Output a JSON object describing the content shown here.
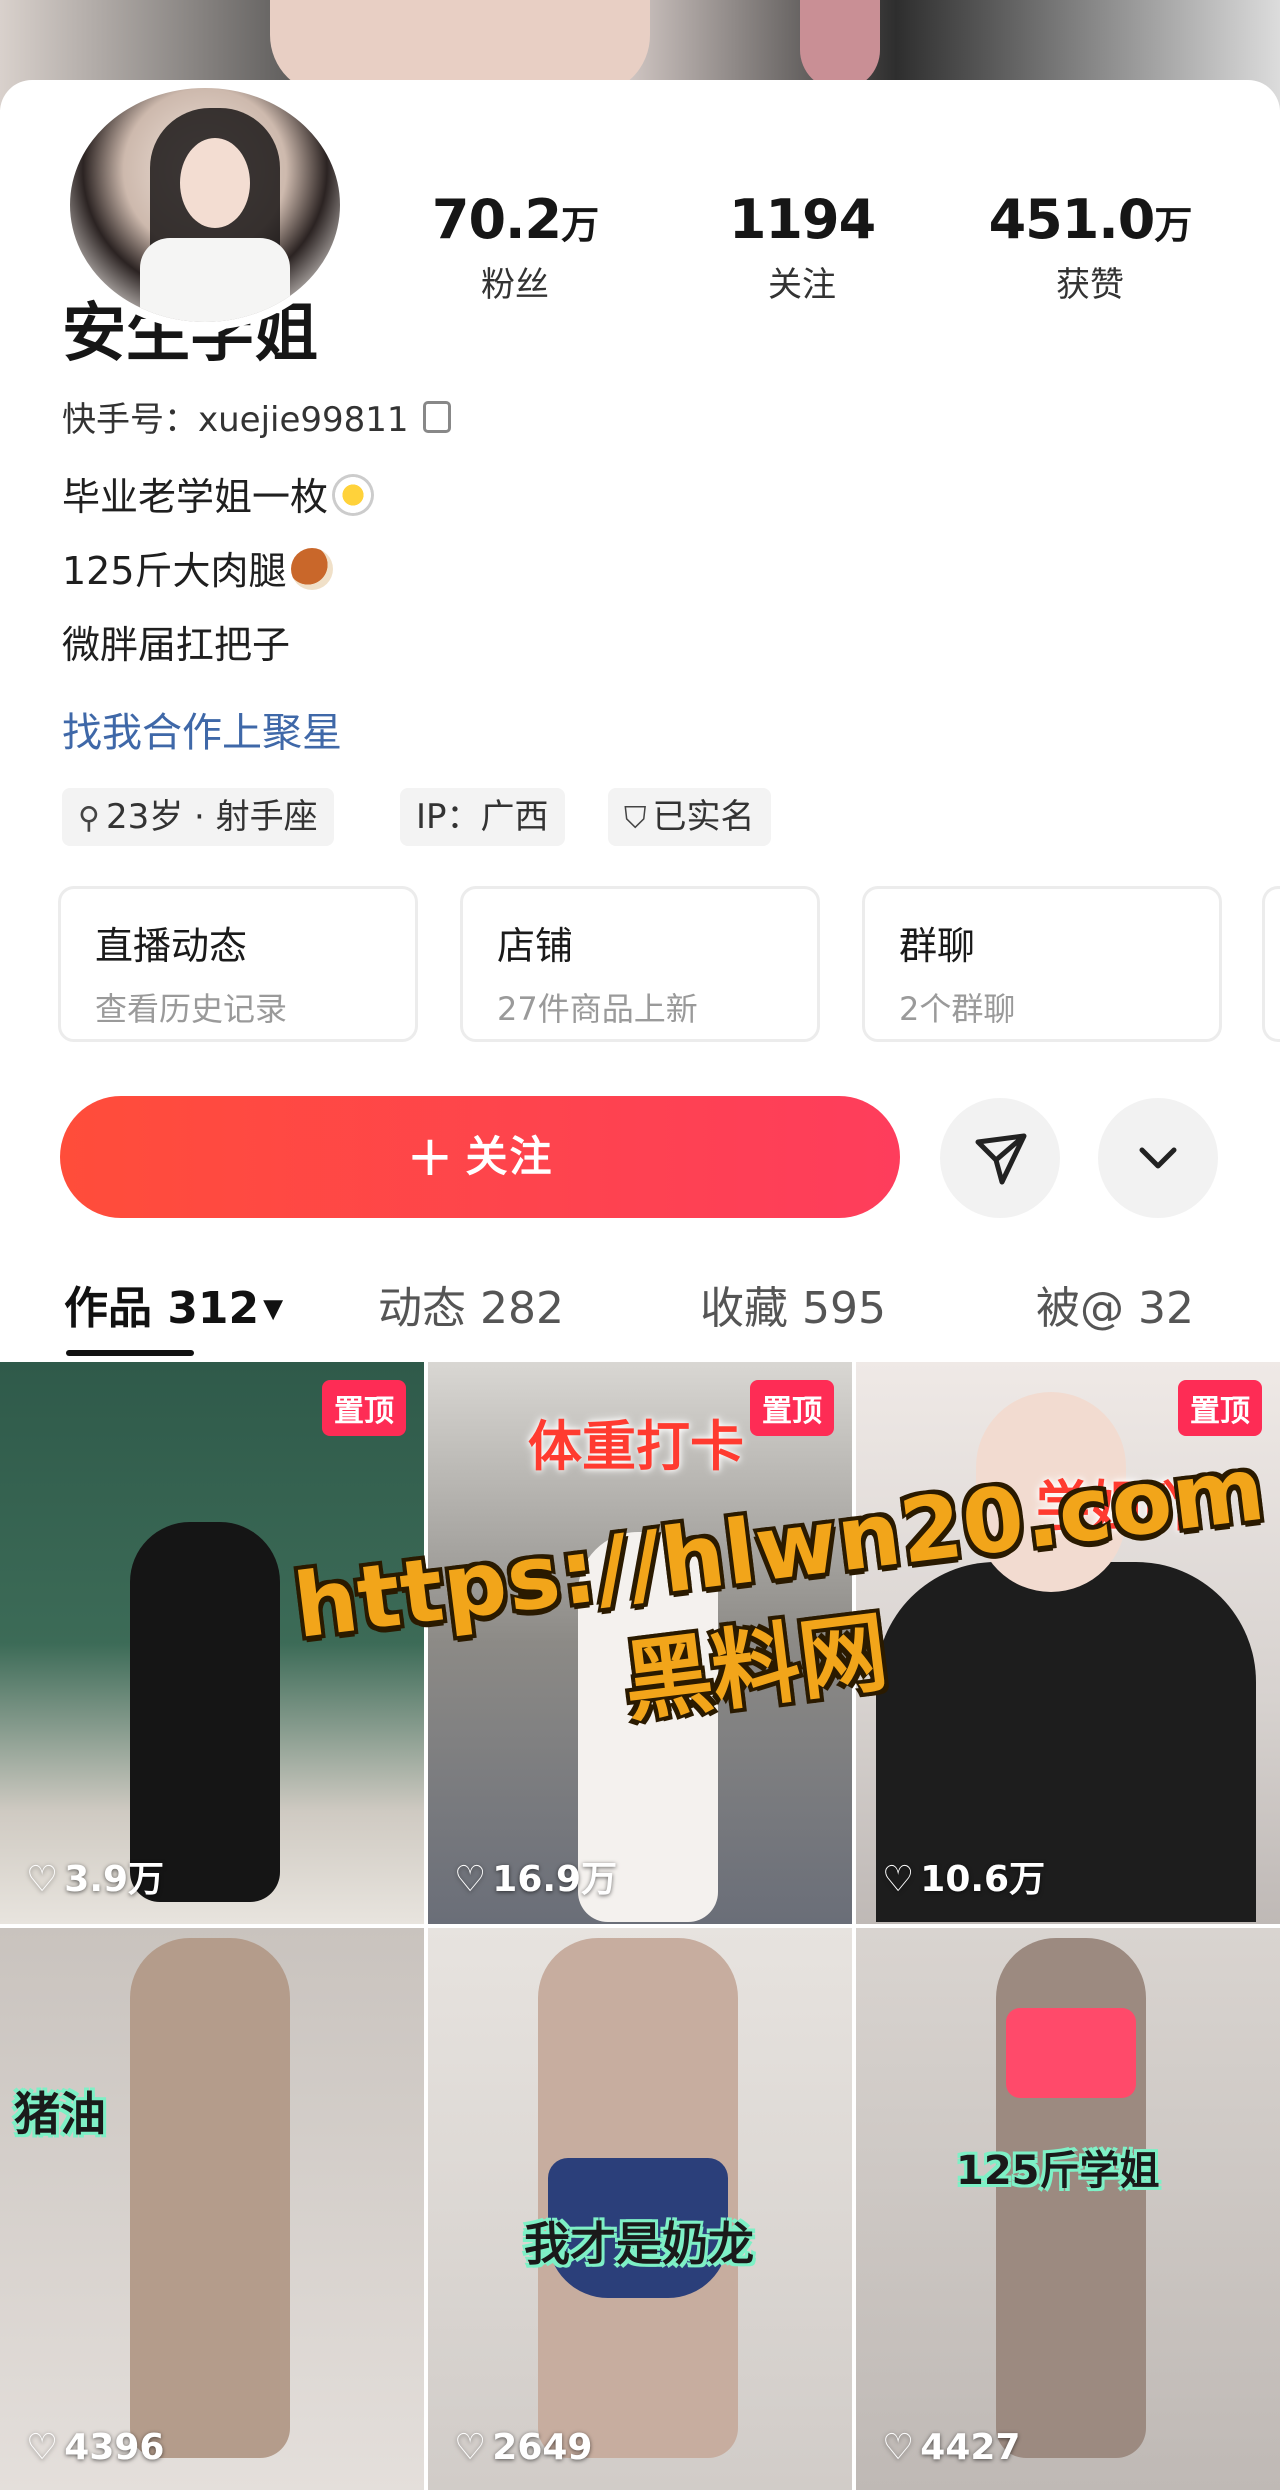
{
  "profile": {
    "name": "安生学姐",
    "uid_label": "快手号：xuejie99811",
    "bio": [
      "毕业老学姐一枚",
      "125斤大肉腿",
      "微胖届扛把子"
    ],
    "link": "找我合作上聚星"
  },
  "stats": [
    {
      "num": "70.2",
      "unit": "万",
      "label": "粉丝"
    },
    {
      "num": "1194",
      "unit": "",
      "label": "关注"
    },
    {
      "num": "451.0",
      "unit": "万",
      "label": "获赞"
    }
  ],
  "tags": {
    "age": "23岁 · 射手座",
    "ip": "IP：广西",
    "verified": "已实名"
  },
  "cards": [
    {
      "title": "直播动态",
      "sub": "查看历史记录"
    },
    {
      "title": "店铺",
      "sub": "27件商品上新"
    },
    {
      "title": "群聊",
      "sub": "2个群聊"
    }
  ],
  "actions": {
    "follow": "关注"
  },
  "tabs": [
    {
      "label": "作品 312"
    },
    {
      "label": "动态 282"
    },
    {
      "label": "收藏 595"
    },
    {
      "label": "被@ 32"
    }
  ],
  "videos": [
    {
      "likes": "3.9万",
      "pinned": "置顶",
      "caption": ""
    },
    {
      "likes": "16.9万",
      "pinned": "置顶",
      "caption": "体重打卡"
    },
    {
      "likes": "10.6万",
      "pinned": "置顶",
      "caption": "学姐吖"
    },
    {
      "likes": "4396",
      "pinned": "",
      "caption": "猪油"
    },
    {
      "likes": "2649",
      "pinned": "",
      "caption": "我才是奶龙"
    },
    {
      "likes": "4427",
      "pinned": "",
      "caption": "125斤学姐"
    }
  ],
  "watermark": {
    "url": "https://hlwn20.com",
    "name": "黑料网"
  },
  "colors": {
    "accent": "#fe2c55",
    "follow_start": "#ff4d3a",
    "link": "#3f68a8",
    "watermark": "#f2a51a"
  }
}
